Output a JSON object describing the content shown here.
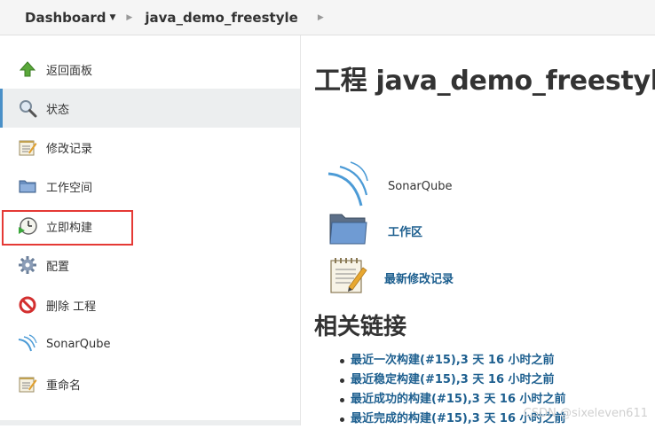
{
  "breadcrumb": {
    "dashboard": "Dashboard",
    "project": "java_demo_freestyle"
  },
  "sidebar": {
    "items": [
      {
        "label": "返回面板",
        "icon": "arrow-up-icon"
      },
      {
        "label": "状态",
        "icon": "magnifier-icon"
      },
      {
        "label": "修改记录",
        "icon": "notepad-icon"
      },
      {
        "label": "工作空间",
        "icon": "folder-icon"
      },
      {
        "label": "立即构建",
        "icon": "clock-build-icon"
      },
      {
        "label": "配置",
        "icon": "gear-icon"
      },
      {
        "label": "删除 工程",
        "icon": "no-entry-icon"
      },
      {
        "label": "SonarQube",
        "icon": "sonarqube-icon"
      },
      {
        "label": "重命名",
        "icon": "notepad-icon"
      }
    ],
    "active_index": 1,
    "highlighted_index": 4
  },
  "main": {
    "title": "工程 java_demo_freestyle",
    "sonarqube_label": "SonarQube",
    "workspace_link": "工作区",
    "changes_link": "最新修改记录",
    "related_title": "相关链接",
    "related_links": [
      "最近一次构建(#15),3 天 16 小时之前",
      "最近稳定构建(#15),3 天 16 小时之前",
      "最近成功的构建(#15),3 天 16 小时之前",
      "最近完成的构建(#15),3 天 16 小时之前"
    ]
  },
  "watermark": "CSDN @sixeleven611"
}
